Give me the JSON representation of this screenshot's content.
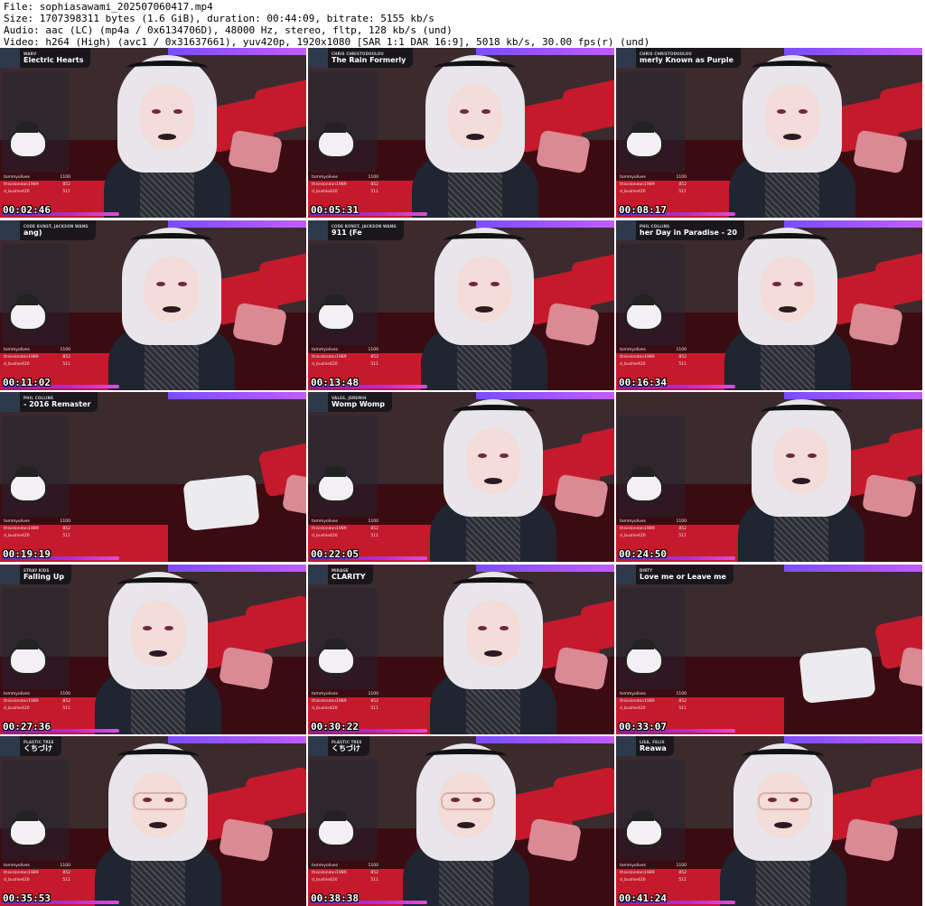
{
  "header": {
    "file_line": "File: sophiasawami_202507060417.mp4",
    "size_line": "Size: 1707398311 bytes (1.6 GiB), duration: 00:44:09, bitrate: 5155 kb/s",
    "audio_line": "Audio: aac (LC) (mp4a / 0x6134706D), 48000 Hz, stereo, fltp, 128 kb/s (und)",
    "video_line": "Video: h264 (High) (avc1 / 0x31637661), yuv420p, 1920x1080 [SAR 1:1 DAR 16:9], 5018 kb/s, 30.00 fps(r) (und)"
  },
  "donors": [
    {
      "name": "tommyolives",
      "value": "1100"
    },
    {
      "name": "thisislondon1989",
      "value": "852"
    },
    {
      "name": "d_bushie420",
      "value": "511"
    }
  ],
  "frames": [
    {
      "timestamp": "00:02:46",
      "artist": "WARV",
      "title": "Electric Hearts",
      "glasses": false
    },
    {
      "timestamp": "00:05:31",
      "artist": "CHRIS CHRISTODOULOU",
      "title": "The Rain Formerly",
      "glasses": false
    },
    {
      "timestamp": "00:08:17",
      "artist": "CHRIS CHRISTODOULOU",
      "title": "merly Known as Purple",
      "glasses": false
    },
    {
      "timestamp": "00:11:02",
      "artist": "CODE KUNST, JACKSON WANG",
      "title": "ang)",
      "glasses": false
    },
    {
      "timestamp": "00:13:48",
      "artist": "CODE KUNST, JACKSON WANG",
      "title": "911 (Fe",
      "glasses": false
    },
    {
      "timestamp": "00:16:34",
      "artist": "PHIL COLLINS",
      "title": "her Day in Paradise - 20",
      "glasses": false
    },
    {
      "timestamp": "00:19:19",
      "artist": "PHIL COLLINS",
      "title": "- 2016 Remaster",
      "glasses": false
    },
    {
      "timestamp": "00:22:05",
      "artist": "VALES, JEREMIH",
      "title": "Womp Womp",
      "glasses": false
    },
    {
      "timestamp": "00:24:50",
      "artist": "",
      "title": "",
      "glasses": false
    },
    {
      "timestamp": "00:27:36",
      "artist": "STRAY KIDS",
      "title": "Falling Up",
      "glasses": false
    },
    {
      "timestamp": "00:30:22",
      "artist": "MIRAGE",
      "title": "CLARITY",
      "glasses": false
    },
    {
      "timestamp": "00:33:07",
      "artist": "DIRTY",
      "title": "Love me or Leave me",
      "glasses": false
    },
    {
      "timestamp": "00:35:53",
      "artist": "PLASTIC TREE",
      "title": "くちづけ",
      "glasses": true
    },
    {
      "timestamp": "00:38:38",
      "artist": "PLASTIC TREE",
      "title": "くちづけ",
      "glasses": true
    },
    {
      "timestamp": "00:41:24",
      "artist": "LISA, FELIX",
      "title": "Reawa",
      "glasses": true
    }
  ],
  "colors": {
    "wall": "#3b2a2e",
    "sofa": "#3a0c12",
    "accent_red": "#c41a2b",
    "led_purple": "#9b4dff"
  }
}
